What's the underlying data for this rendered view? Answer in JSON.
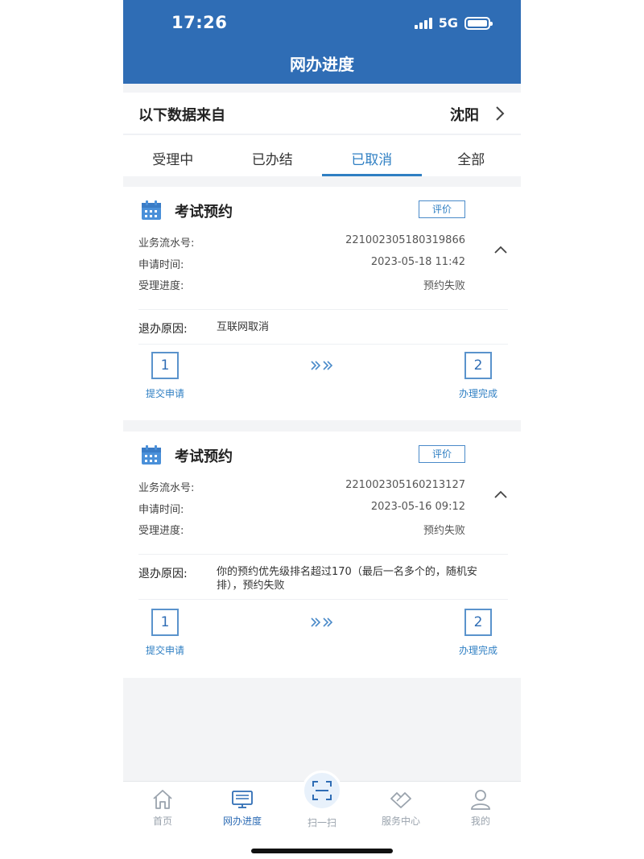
{
  "status_bar": {
    "time": "17:26",
    "network": "5G"
  },
  "header": {
    "title": "网办进度"
  },
  "source": {
    "label": "以下数据来自",
    "city": "沈阳"
  },
  "tabs": [
    {
      "label": "受理中",
      "active": false
    },
    {
      "label": "已办结",
      "active": false
    },
    {
      "label": "已取消",
      "active": true
    },
    {
      "label": "全部",
      "active": false
    }
  ],
  "cards": [
    {
      "title": "考试预约",
      "eval_label": "评价",
      "serial_label": "业务流水号:",
      "serial_value": "221002305180319866",
      "time_label": "申请时间:",
      "time_value": "2023-05-18 11:42",
      "progress_label": "受理进度:",
      "progress_value": "预约失败",
      "reason_label": "退办原因:",
      "reason_value": "互联网取消",
      "step1_num": "1",
      "step1_label": "提交申请",
      "step2_num": "2",
      "step2_label": "办理完成"
    },
    {
      "title": "考试预约",
      "eval_label": "评价",
      "serial_label": "业务流水号:",
      "serial_value": "221002305160213127",
      "time_label": "申请时间:",
      "time_value": "2023-05-16 09:12",
      "progress_label": "受理进度:",
      "progress_value": "预约失败",
      "reason_label": "退办原因:",
      "reason_value": "你的预约优先级排名超过170（最后一名多个的，随机安排），预约失败",
      "step1_num": "1",
      "step1_label": "提交申请",
      "step2_num": "2",
      "step2_label": "办理完成"
    }
  ],
  "bottom_nav": [
    {
      "label": "首页",
      "icon": "home-icon",
      "active": false
    },
    {
      "label": "网办进度",
      "icon": "monitor-icon",
      "active": true
    },
    {
      "label": "扫一扫",
      "icon": "scan-icon",
      "active": false
    },
    {
      "label": "服务中心",
      "icon": "handshake-icon",
      "active": false
    },
    {
      "label": "我的",
      "icon": "user-icon",
      "active": false
    }
  ],
  "colors": {
    "primary": "#2f6db5",
    "accent": "#2f7fc3",
    "background": "#f3f4f6"
  }
}
